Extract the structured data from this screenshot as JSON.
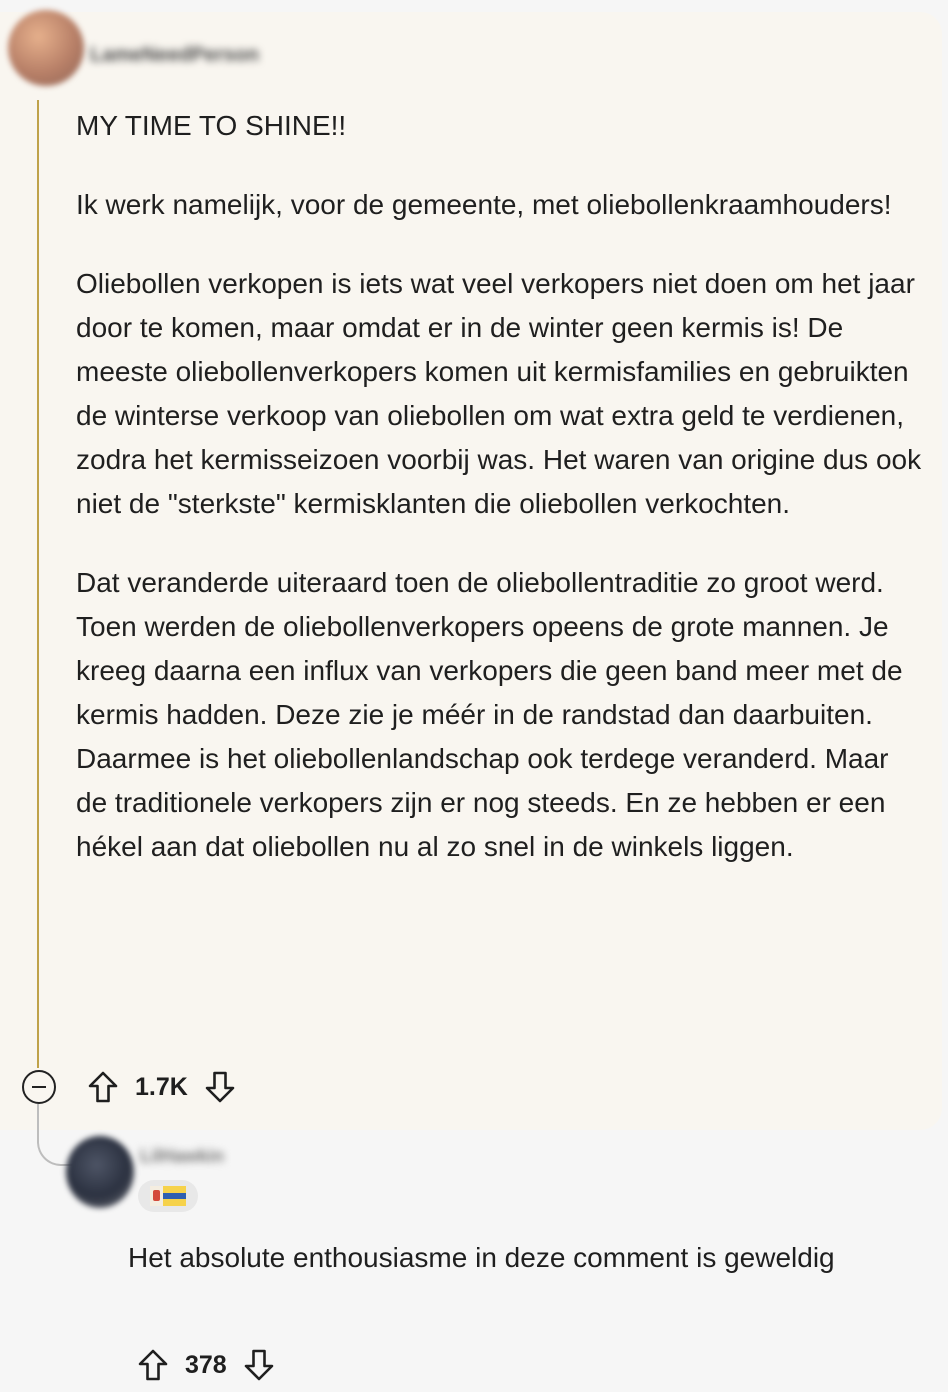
{
  "comment": {
    "username": "LameNeedPerson",
    "paragraphs": [
      "MY TIME TO SHINE!!",
      "Ik werk namelijk, voor de gemeente, met oliebollenkraamhouders!",
      "Oliebollen verkopen is iets wat veel verkopers niet doen om het jaar door te komen, maar omdat er in de winter geen kermis is! De meeste oliebollenverkopers komen uit kermisfamilies en gebruikten de winterse verkoop van oliebollen om wat extra geld te verdienen, zodra het kermisseizoen voorbij was. Het waren van origine dus ook niet de \"sterkste\" kermisklanten die oliebollen verkochten.",
      "Dat veranderde uiteraard toen de oliebollentraditie zo groot werd. Toen werden de oliebollenverkopers opeens de grote mannen. Je kreeg daarna een influx van verkopers die geen band meer met de kermis hadden. Deze zie je méér in de randstad dan daarbuiten. Daarmee is het oliebollenlandschap ook terdege veranderd. Maar de traditionele verkopers zijn er nog steeds. En ze hebben er een hékel aan dat oliebollen nu al zo snel in de winkels liggen."
    ],
    "score": "1.7K"
  },
  "reply": {
    "username": "LilHawkin",
    "text": "Het absolute enthousiasme in deze comment is geweldig",
    "score": "378"
  },
  "icons": {
    "collapse": "collapse-minus-icon",
    "upvote": "upvote-arrow-icon",
    "downvote": "downvote-arrow-icon",
    "flair": "limburg-flag-icon"
  },
  "colors": {
    "thread_line": "#bfa24a",
    "card_background": "#f9f6f0",
    "page_background": "#f6f6f6"
  }
}
